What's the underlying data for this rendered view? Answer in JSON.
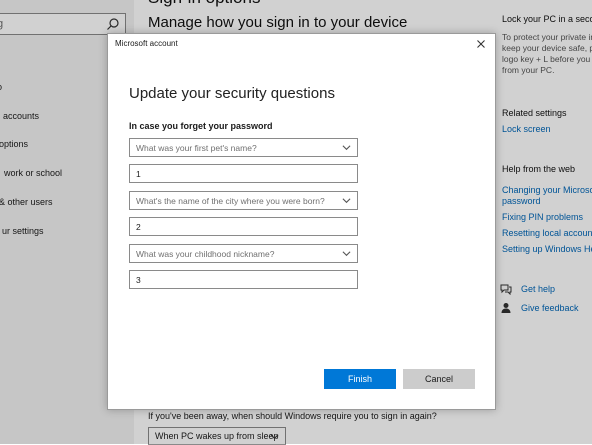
{
  "background": {
    "header_cut": "Sign-in options",
    "main_title": "Manage how you sign in to your device",
    "search": {
      "placeholder": "g"
    },
    "sidebar_items": [
      "o",
      "accounts",
      "options",
      "work or school",
      "& other users",
      "ur settings"
    ],
    "right": {
      "lock_title": "Lock your PC in a second",
      "lock_body": [
        "To protect your private in",
        "keep your device safe, pr",
        "logo key + L before you",
        "from your PC."
      ],
      "related_heading": "Related settings",
      "lock_screen_link": "Lock screen",
      "help_heading": "Help from the web",
      "help_links": [
        "Changing your Microsoft",
        "password",
        "Fixing PIN problems",
        "Resetting local account p",
        "Setting up Windows Hell"
      ],
      "get_help": "Get help",
      "give_feedback": "Give feedback"
    },
    "away_question": "If you've been away, when should Windows require you to sign in again?",
    "sleep_select": "When PC wakes up from sleep"
  },
  "dialog": {
    "title": "Microsoft account",
    "heading": "Update your security questions",
    "subheading": "In case you forget your password",
    "questions": [
      {
        "question": "What was your first pet's name?",
        "answer": "1"
      },
      {
        "question": "What's the name of the city where you were born?",
        "answer": "2"
      },
      {
        "question": "What was your childhood nickname?",
        "answer": "3"
      }
    ],
    "finish_label": "Finish",
    "cancel_label": "Cancel"
  },
  "colors": {
    "accent": "#0078d7",
    "link": "#0067b8",
    "sidebar_bg": "#f2f2f2"
  }
}
